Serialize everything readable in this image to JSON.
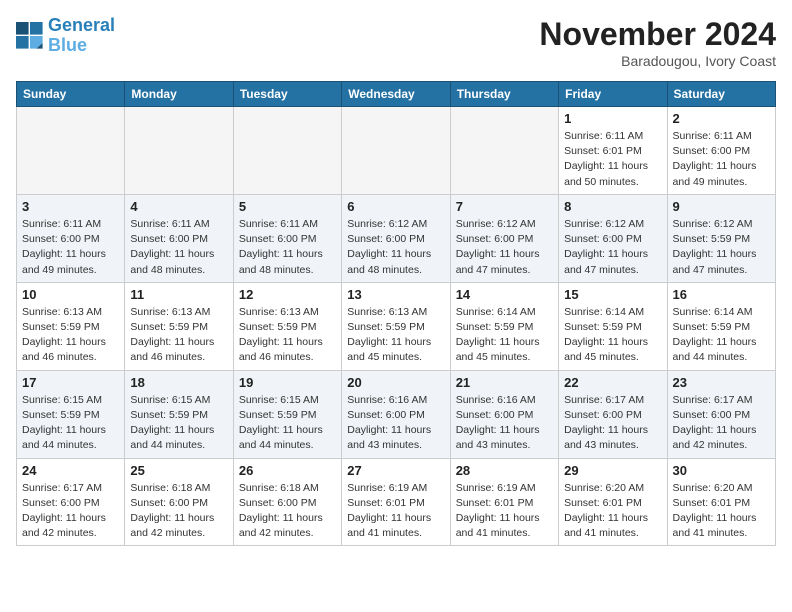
{
  "logo": {
    "line1": "General",
    "line2": "Blue"
  },
  "title": "November 2024",
  "subtitle": "Baradougou, Ivory Coast",
  "weekdays": [
    "Sunday",
    "Monday",
    "Tuesday",
    "Wednesday",
    "Thursday",
    "Friday",
    "Saturday"
  ],
  "weeks": [
    [
      {
        "day": "",
        "info": ""
      },
      {
        "day": "",
        "info": ""
      },
      {
        "day": "",
        "info": ""
      },
      {
        "day": "",
        "info": ""
      },
      {
        "day": "",
        "info": ""
      },
      {
        "day": "1",
        "info": "Sunrise: 6:11 AM\nSunset: 6:01 PM\nDaylight: 11 hours\nand 50 minutes."
      },
      {
        "day": "2",
        "info": "Sunrise: 6:11 AM\nSunset: 6:00 PM\nDaylight: 11 hours\nand 49 minutes."
      }
    ],
    [
      {
        "day": "3",
        "info": "Sunrise: 6:11 AM\nSunset: 6:00 PM\nDaylight: 11 hours\nand 49 minutes."
      },
      {
        "day": "4",
        "info": "Sunrise: 6:11 AM\nSunset: 6:00 PM\nDaylight: 11 hours\nand 48 minutes."
      },
      {
        "day": "5",
        "info": "Sunrise: 6:11 AM\nSunset: 6:00 PM\nDaylight: 11 hours\nand 48 minutes."
      },
      {
        "day": "6",
        "info": "Sunrise: 6:12 AM\nSunset: 6:00 PM\nDaylight: 11 hours\nand 48 minutes."
      },
      {
        "day": "7",
        "info": "Sunrise: 6:12 AM\nSunset: 6:00 PM\nDaylight: 11 hours\nand 47 minutes."
      },
      {
        "day": "8",
        "info": "Sunrise: 6:12 AM\nSunset: 6:00 PM\nDaylight: 11 hours\nand 47 minutes."
      },
      {
        "day": "9",
        "info": "Sunrise: 6:12 AM\nSunset: 5:59 PM\nDaylight: 11 hours\nand 47 minutes."
      }
    ],
    [
      {
        "day": "10",
        "info": "Sunrise: 6:13 AM\nSunset: 5:59 PM\nDaylight: 11 hours\nand 46 minutes."
      },
      {
        "day": "11",
        "info": "Sunrise: 6:13 AM\nSunset: 5:59 PM\nDaylight: 11 hours\nand 46 minutes."
      },
      {
        "day": "12",
        "info": "Sunrise: 6:13 AM\nSunset: 5:59 PM\nDaylight: 11 hours\nand 46 minutes."
      },
      {
        "day": "13",
        "info": "Sunrise: 6:13 AM\nSunset: 5:59 PM\nDaylight: 11 hours\nand 45 minutes."
      },
      {
        "day": "14",
        "info": "Sunrise: 6:14 AM\nSunset: 5:59 PM\nDaylight: 11 hours\nand 45 minutes."
      },
      {
        "day": "15",
        "info": "Sunrise: 6:14 AM\nSunset: 5:59 PM\nDaylight: 11 hours\nand 45 minutes."
      },
      {
        "day": "16",
        "info": "Sunrise: 6:14 AM\nSunset: 5:59 PM\nDaylight: 11 hours\nand 44 minutes."
      }
    ],
    [
      {
        "day": "17",
        "info": "Sunrise: 6:15 AM\nSunset: 5:59 PM\nDaylight: 11 hours\nand 44 minutes."
      },
      {
        "day": "18",
        "info": "Sunrise: 6:15 AM\nSunset: 5:59 PM\nDaylight: 11 hours\nand 44 minutes."
      },
      {
        "day": "19",
        "info": "Sunrise: 6:15 AM\nSunset: 5:59 PM\nDaylight: 11 hours\nand 44 minutes."
      },
      {
        "day": "20",
        "info": "Sunrise: 6:16 AM\nSunset: 6:00 PM\nDaylight: 11 hours\nand 43 minutes."
      },
      {
        "day": "21",
        "info": "Sunrise: 6:16 AM\nSunset: 6:00 PM\nDaylight: 11 hours\nand 43 minutes."
      },
      {
        "day": "22",
        "info": "Sunrise: 6:17 AM\nSunset: 6:00 PM\nDaylight: 11 hours\nand 43 minutes."
      },
      {
        "day": "23",
        "info": "Sunrise: 6:17 AM\nSunset: 6:00 PM\nDaylight: 11 hours\nand 42 minutes."
      }
    ],
    [
      {
        "day": "24",
        "info": "Sunrise: 6:17 AM\nSunset: 6:00 PM\nDaylight: 11 hours\nand 42 minutes."
      },
      {
        "day": "25",
        "info": "Sunrise: 6:18 AM\nSunset: 6:00 PM\nDaylight: 11 hours\nand 42 minutes."
      },
      {
        "day": "26",
        "info": "Sunrise: 6:18 AM\nSunset: 6:00 PM\nDaylight: 11 hours\nand 42 minutes."
      },
      {
        "day": "27",
        "info": "Sunrise: 6:19 AM\nSunset: 6:01 PM\nDaylight: 11 hours\nand 41 minutes."
      },
      {
        "day": "28",
        "info": "Sunrise: 6:19 AM\nSunset: 6:01 PM\nDaylight: 11 hours\nand 41 minutes."
      },
      {
        "day": "29",
        "info": "Sunrise: 6:20 AM\nSunset: 6:01 PM\nDaylight: 11 hours\nand 41 minutes."
      },
      {
        "day": "30",
        "info": "Sunrise: 6:20 AM\nSunset: 6:01 PM\nDaylight: 11 hours\nand 41 minutes."
      }
    ]
  ]
}
